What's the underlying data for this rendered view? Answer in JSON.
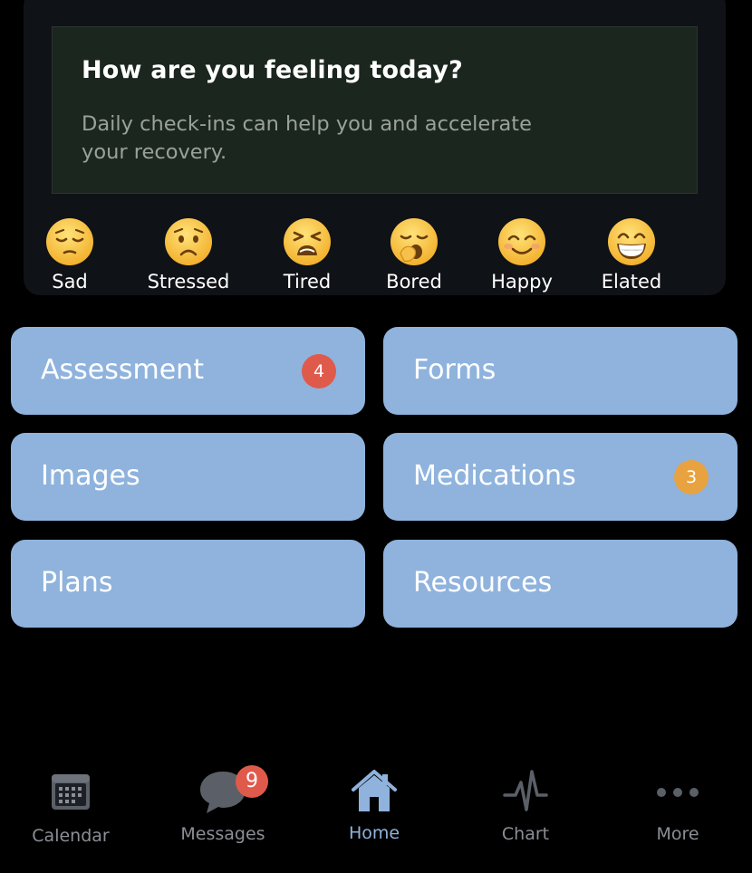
{
  "checkin": {
    "title": "How are you feeling today?",
    "subtitle": "Daily check-ins can help you and accelerate your recovery.",
    "moods": [
      {
        "label": "Sad",
        "icon": "pensive-face-icon"
      },
      {
        "label": "Stressed",
        "icon": "worried-face-icon"
      },
      {
        "label": "Tired",
        "icon": "tired-face-icon"
      },
      {
        "label": "Bored",
        "icon": "yawning-face-icon"
      },
      {
        "label": "Happy",
        "icon": "smiling-face-icon"
      },
      {
        "label": "Elated",
        "icon": "grinning-face-icon"
      }
    ]
  },
  "tiles": [
    {
      "label": "Assessment",
      "badge": "4",
      "badge_color": "#e05a4b"
    },
    {
      "label": "Forms"
    },
    {
      "label": "Images"
    },
    {
      "label": "Medications",
      "badge": "3",
      "badge_color": "#e8a240"
    },
    {
      "label": "Plans"
    },
    {
      "label": "Resources"
    }
  ],
  "tabbar": {
    "items": [
      {
        "label": "Calendar",
        "icon": "calendar-icon"
      },
      {
        "label": "Messages",
        "icon": "chat-bubble-icon",
        "badge": "9"
      },
      {
        "label": "Home",
        "icon": "house-icon",
        "active": true
      },
      {
        "label": "Chart",
        "icon": "pulse-icon"
      },
      {
        "label": "More",
        "icon": "ellipsis-icon"
      }
    ]
  },
  "colors": {
    "background": "#000000",
    "card": "#0f1217",
    "banner": "#1b261f",
    "tile": "#8fb3dd",
    "accent": "#8fb3dd",
    "badge_red": "#e05a4b",
    "badge_orange": "#e8a240",
    "inactive_tab": "#8b8f96"
  }
}
